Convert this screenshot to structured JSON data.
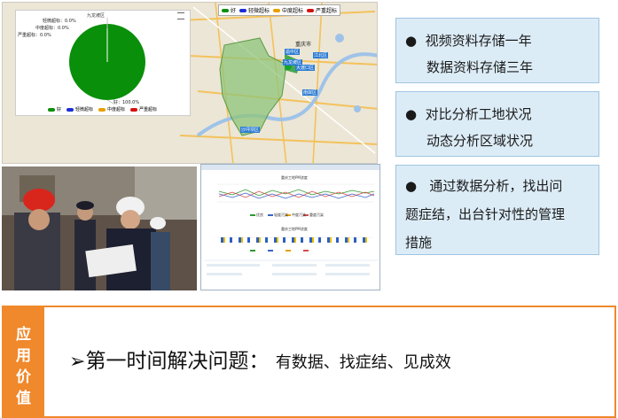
{
  "map": {
    "legend": [
      {
        "label": "好",
        "color": "#0a8f0a"
      },
      {
        "label": "轻微超标",
        "color": "#1b2fd6"
      },
      {
        "label": "中度超标",
        "color": "#e8a000"
      },
      {
        "label": "严重超标",
        "color": "#d41212"
      }
    ],
    "pie": {
      "title": "九龙坡区",
      "labels": [
        "轻微超标：0.0%",
        "中度超标：0.0%",
        "严重超标：0.0%",
        "好：100.0%"
      ],
      "legend": [
        "好",
        "轻微超标",
        "中度超标",
        "严重超标"
      ]
    },
    "place_labels": [
      "重庆市",
      "渝中区",
      "江北区",
      "九龙坡区",
      "大渡口区",
      "南岸区",
      "沙坪坝区"
    ]
  },
  "info_boxes": [
    {
      "lines": [
        "视频资料存储一年",
        "数据资料存储三年"
      ]
    },
    {
      "lines": [
        "对比分析工地状况",
        "动态分析区域状况"
      ]
    },
    {
      "lines": [
        "通过数据分析，找出问",
        "题症结，出台针对性的管理",
        "措施"
      ]
    }
  ],
  "dashboard": {
    "chart1_title": "重庆工地PM浓度",
    "chart2_title": "重庆工地PM浓度",
    "legend": [
      "优良",
      "轻度污染",
      "中度污染",
      "重度污染"
    ]
  },
  "banner": {
    "side_label": [
      "应",
      "用",
      "价",
      "值"
    ],
    "arrow": "➢",
    "headline": "第一时间解决问题：",
    "detail": "有数据、找症结、见成效"
  }
}
